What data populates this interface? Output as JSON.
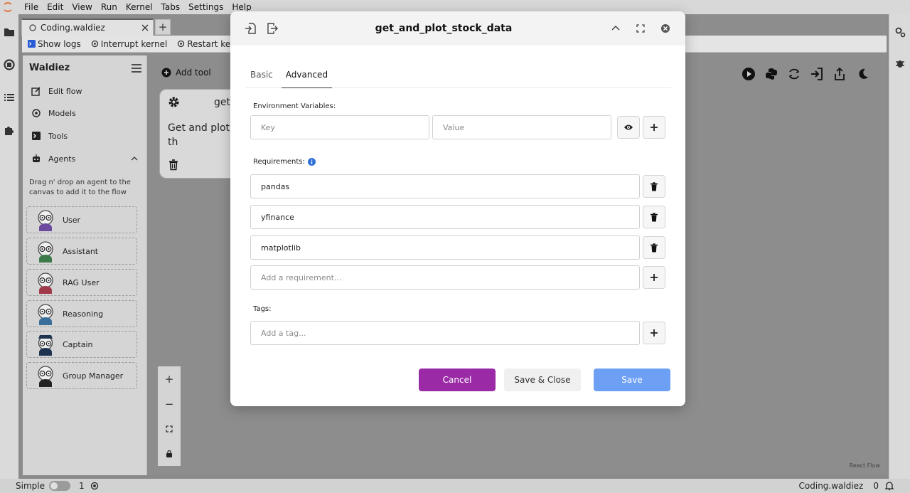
{
  "menubar": {
    "items": [
      "File",
      "Edit",
      "View",
      "Run",
      "Kernel",
      "Tabs",
      "Settings",
      "Help"
    ]
  },
  "document_tab": {
    "name": "Coding.waldiez",
    "new_tab_label": "+"
  },
  "toolbar": {
    "show_logs": "Show logs",
    "interrupt_kernel": "Interrupt kernel",
    "restart_kernel": "Restart kernel"
  },
  "sidebar": {
    "title": "Waldiez",
    "nav": [
      {
        "label": "Edit flow",
        "icon": "edit-icon"
      },
      {
        "label": "Models",
        "icon": "models-icon"
      },
      {
        "label": "Tools",
        "icon": "terminal-icon"
      },
      {
        "label": "Agents",
        "icon": "robot-icon"
      }
    ],
    "hint": "Drag n' drop an agent to the canvas to add it to the flow",
    "agents": [
      "User",
      "Assistant",
      "RAG User",
      "Reasoning",
      "Captain",
      "Group Manager"
    ]
  },
  "canvas": {
    "add_tool_label": "Add tool",
    "node_label": "get",
    "node_description": "Get and plot stock prices for th",
    "controls": [
      "+",
      "−"
    ],
    "attribution": "React Flow"
  },
  "statusbar": {
    "mode": "Simple",
    "kernel_count": "1",
    "file": "Coding.waldiez",
    "notifications": "0"
  },
  "modal": {
    "title": "get_and_plot_stock_data",
    "tabs": [
      "Basic",
      "Advanced"
    ],
    "active_tab": "Advanced",
    "env_label": "Environment Variables:",
    "key_placeholder": "Key",
    "value_placeholder": "Value",
    "requirements_label": "Requirements:",
    "requirements": [
      "pandas",
      "yfinance",
      "matplotlib"
    ],
    "requirement_placeholder": "Add a requirement...",
    "tags_label": "Tags:",
    "tag_placeholder": "Add a tag...",
    "buttons": {
      "cancel": "Cancel",
      "save_close": "Save & Close",
      "save": "Save"
    }
  },
  "colors": {
    "cancel": "#9b2aa6",
    "save": "#6d9ff5",
    "info": "#2f6fd6"
  }
}
